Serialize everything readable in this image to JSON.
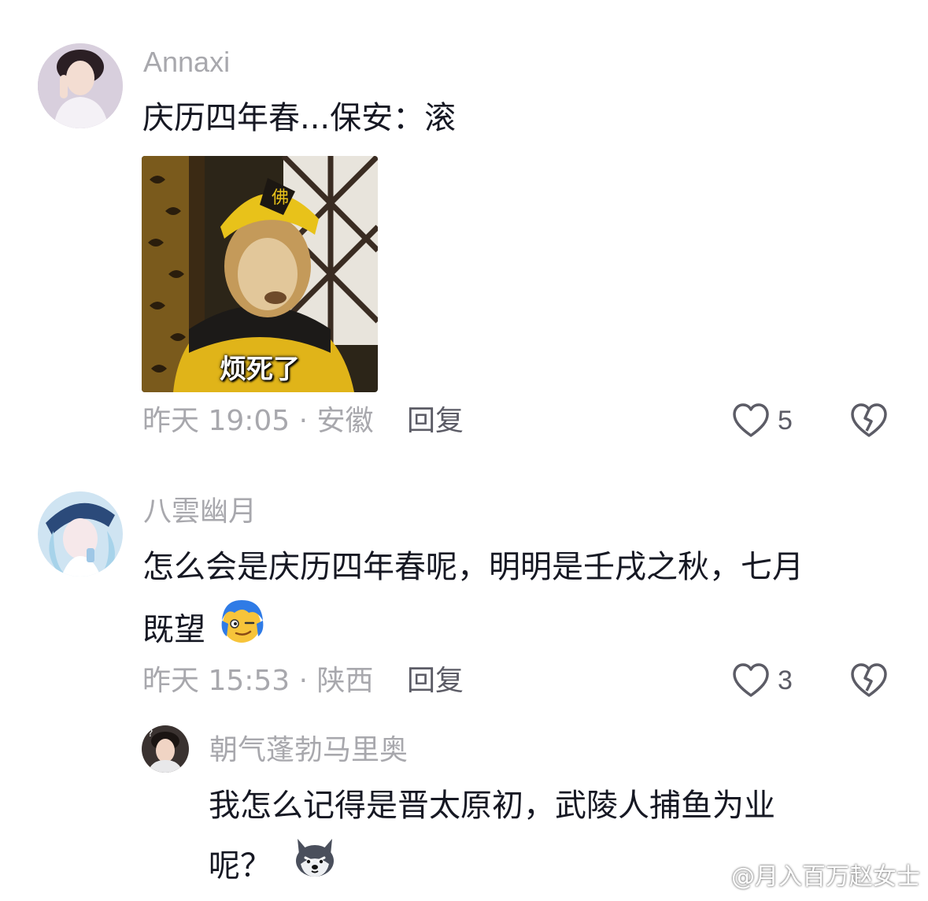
{
  "comments": [
    {
      "username": "Annaxi",
      "text": "庆历四年春...保安：滚",
      "meme_caption": "烦死了",
      "time_location": "昨天 19:05 · 安徽",
      "reply_label": "回复",
      "likes": "5"
    },
    {
      "username": "八雲幽月",
      "text_line1": "怎么会是庆历四年春呢，明明是壬戌之秋，七月",
      "text_line2": "既望",
      "emoji_name": "smirk-face-emoji",
      "time_location": "昨天 15:53 · 陕西",
      "reply_label": "回复",
      "likes": "3"
    }
  ],
  "reply": {
    "username": "朝气蓬勃马里奥",
    "text_line1": "我怎么记得是晋太原初，武陵人捕鱼为业",
    "text_line2": "呢？",
    "emoji_name": "husky-dog-emoji"
  },
  "watermark": {
    "text": "@月入百万赵女士"
  },
  "colors": {
    "text_primary": "#161823",
    "text_secondary": "#a8a8ad",
    "reply_label": "#5c5c66",
    "icon": "#5c5c66"
  }
}
